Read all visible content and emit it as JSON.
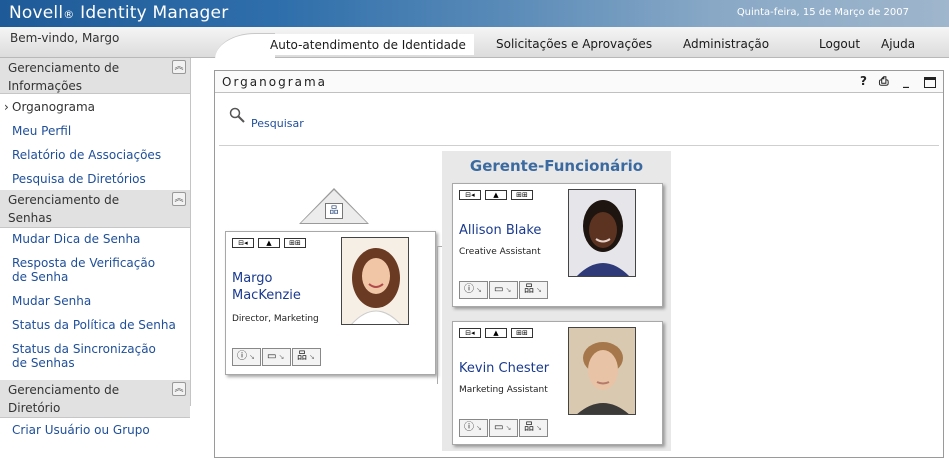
{
  "header": {
    "brand": "Novell",
    "brand_reg": "®",
    "brand_product": "Identity Manager",
    "date": "Quinta-feira, 15 de Março de 2007"
  },
  "nav": {
    "welcome": "Bem-vindo, Margo",
    "tabs": [
      {
        "label": "Auto-atendimento de Identidade",
        "active": true
      },
      {
        "label": "Solicitações e Aprovações"
      },
      {
        "label": "Administração"
      },
      {
        "label": "Logout"
      },
      {
        "label": "Ajuda"
      }
    ]
  },
  "sidebar": {
    "sections": [
      {
        "title": "Gerenciamento de Informações",
        "items": [
          "Organograma",
          "Meu Perfil",
          "Relatório de Associações",
          "Pesquisa de Diretórios"
        ]
      },
      {
        "title": "Gerenciamento de Senhas",
        "items": [
          "Mudar Dica de Senha",
          "Resposta de Verificação de Senha",
          "Mudar Senha",
          "Status da Política de Senha",
          "Status da Sincronização de Senhas"
        ]
      },
      {
        "title": "Gerenciamento de Diretório",
        "items": [
          "Criar Usuário ou Grupo"
        ]
      }
    ]
  },
  "panel": {
    "title": "Organograma",
    "help_icon": "?",
    "search_label": "Pesquisar"
  },
  "org": {
    "group_title": "Gerente-Funcionário",
    "root": {
      "first": "Margo",
      "last": "MacKenzie",
      "role": "Director, Marketing"
    },
    "reports": [
      {
        "name": "Allison Blake",
        "role": "Creative Assistant"
      },
      {
        "name": "Kevin Chester",
        "role": "Marketing Assistant"
      }
    ]
  },
  "colors": {
    "header_blue": "#2f6fab",
    "link_blue": "#1f4f99",
    "group_title": "#3b6aa0"
  }
}
